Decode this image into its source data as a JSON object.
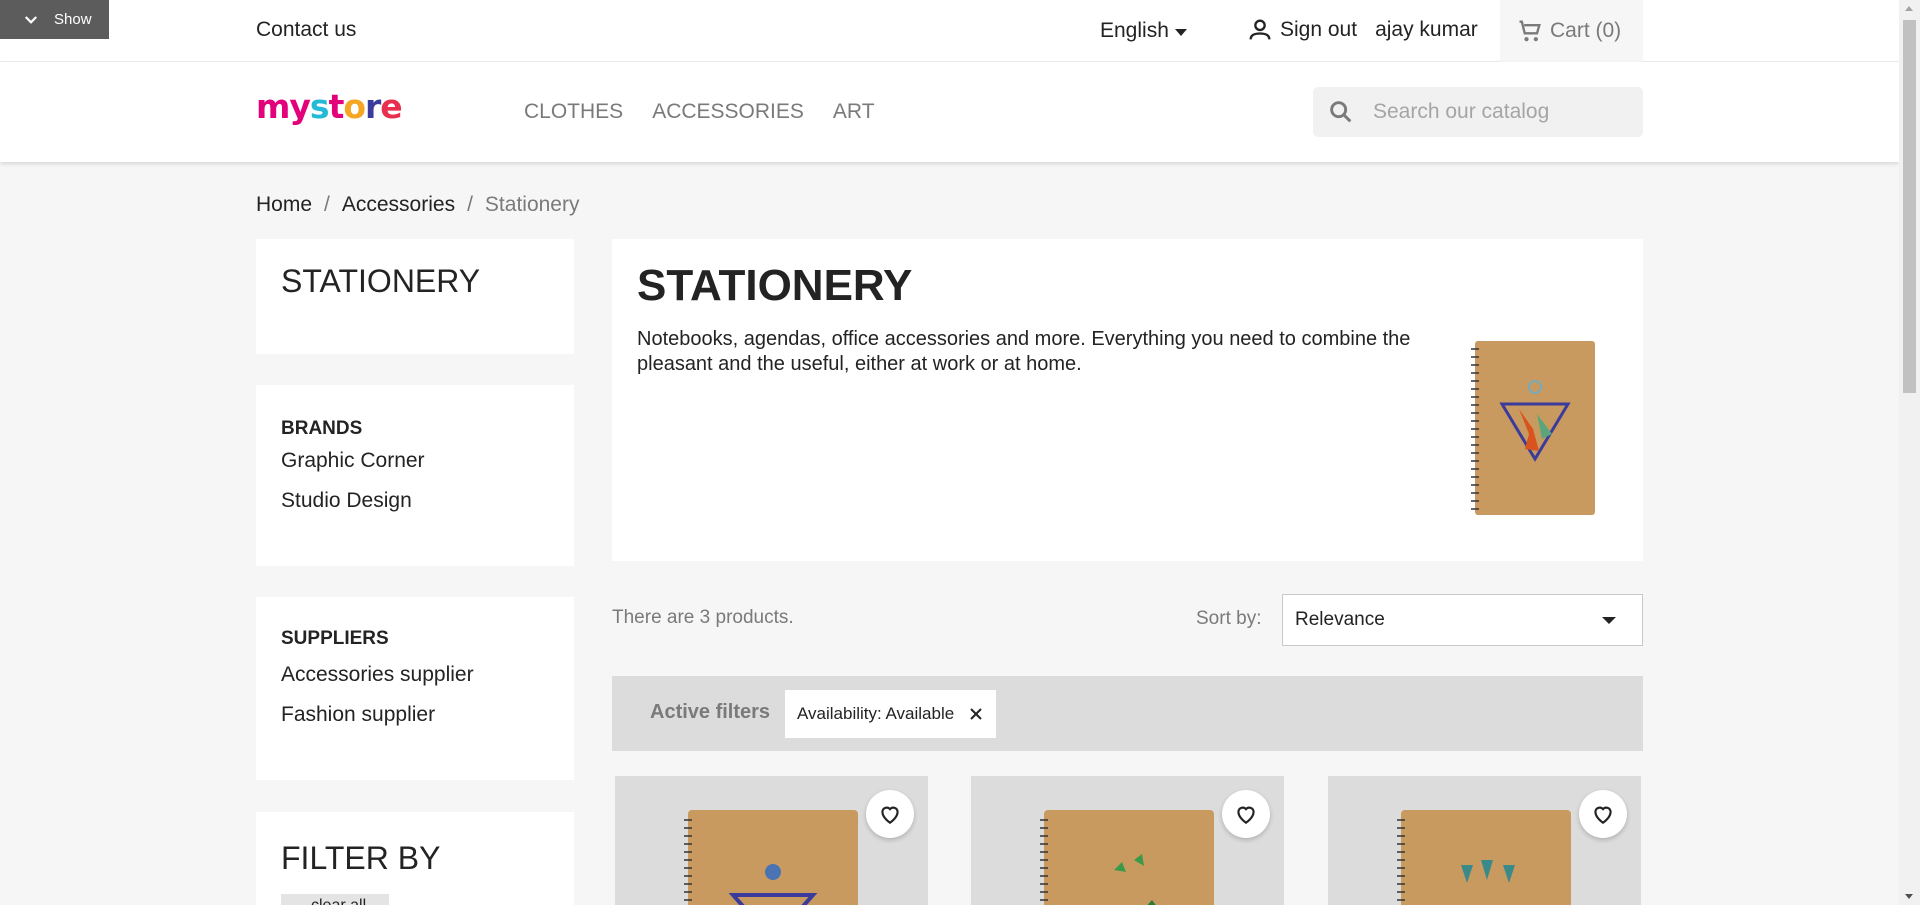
{
  "debug": {
    "label": "Show"
  },
  "header": {
    "contact": "Contact us",
    "language": "English",
    "signout": "Sign out",
    "username": "ajay kumar",
    "cart": "Cart (0)"
  },
  "logo": {
    "parts": [
      "my",
      " ",
      "s",
      "t",
      "o",
      "r",
      "e"
    ]
  },
  "menu": [
    "CLOTHES",
    "ACCESSORIES",
    "ART"
  ],
  "search": {
    "placeholder": "Search our catalog"
  },
  "breadcrumb": {
    "home": "Home",
    "accessories": "Accessories",
    "current": "Stationery"
  },
  "left": {
    "category_title": "STATIONERY",
    "brands_title": "BRANDS",
    "brands": [
      "Graphic Corner",
      "Studio Design"
    ],
    "suppliers_title": "SUPPLIERS",
    "suppliers": [
      "Accessories supplier",
      "Fashion supplier"
    ],
    "filter_title": "FILTER BY",
    "filter_chip": "clear all"
  },
  "category": {
    "title": "STATIONERY",
    "description": "Notebooks, agendas, office accessories and more. Everything you need to combine the pleasant and the useful, either at work or at home."
  },
  "listing": {
    "count": "There are 3 products.",
    "sort_label": "Sort by:",
    "sort_value": "Relevance",
    "active_filters_title": "Active filters",
    "active_filter": "Availability: Available"
  },
  "colors": {
    "accent": "#24b9d7",
    "brand_pink": "#e3007b"
  }
}
